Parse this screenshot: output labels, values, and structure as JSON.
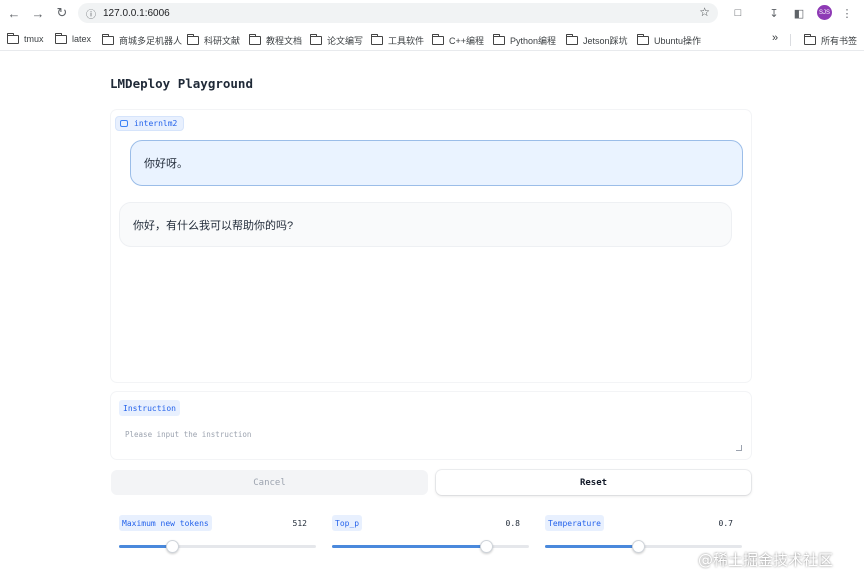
{
  "browser": {
    "url": "127.0.0.1:6006",
    "profile_initials": "SJS",
    "bookmarks": [
      "tmux",
      "latex",
      "商城多足机器人",
      "科研文献",
      "教程文档",
      "论文编写",
      "工具软件",
      "C++编程",
      "Python编程",
      "Jetson踩坑",
      "Ubuntu操作"
    ],
    "overflow": "»",
    "all_bookmarks": "所有书签"
  },
  "page": {
    "title": "LMDeploy Playground"
  },
  "chat": {
    "model_label": "internlm2",
    "messages": [
      {
        "role": "user",
        "text": "你好呀。"
      },
      {
        "role": "assistant",
        "text": "你好，有什么我可以帮助你的吗?"
      }
    ]
  },
  "instruction": {
    "label": "Instruction",
    "placeholder": "Please input the instruction",
    "value": ""
  },
  "buttons": {
    "cancel": "Cancel",
    "reset": "Reset"
  },
  "params": {
    "max_tokens": {
      "label": "Maximum new tokens",
      "value": "512",
      "fraction": 0.27
    },
    "top_p": {
      "label": "Top_p",
      "value": "0.8",
      "fraction": 0.78
    },
    "temperature": {
      "label": "Temperature",
      "value": "0.7",
      "fraction": 0.47
    }
  },
  "watermark": "@稀土掘金技术社区",
  "colors": {
    "accent": "#2563eb",
    "label_bg": "#e8f0fe",
    "user_bubble": "#eaf3ff",
    "slider_fill": "#4a89dc"
  }
}
